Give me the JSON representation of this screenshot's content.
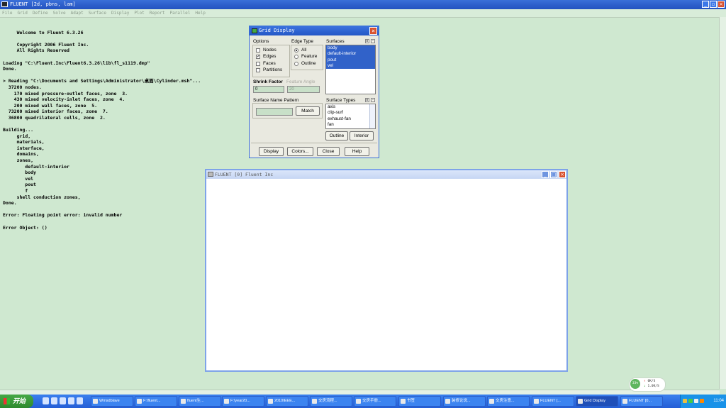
{
  "main_window": {
    "title": "FLUENT  [2d, pbns, lam]",
    "menu": [
      "File",
      "Grid",
      "Define",
      "Solve",
      "Adapt",
      "Surface",
      "Display",
      "Plot",
      "Report",
      "Parallel",
      "Help"
    ]
  },
  "console": {
    "lines": [
      "",
      "     Welcome to Fluent 6.3.26",
      "",
      "     Copyright 2006 Fluent Inc.",
      "     All Rights Reserved",
      "",
      "Loading \"C:\\Fluent.Inc\\Fluent6.3.26\\lib\\fl_s1119.dmp\"",
      "Done.",
      "",
      "> Reading \"C:\\Documents and Settings\\Administrator\\桌面\\Cylinder.msh\"...",
      "  37200 nodes.",
      "    170 mixed pressure-outlet faces, zone  3.",
      "    430 mixed velocity-inlet faces, zone  4.",
      "    200 mixed wall faces, zone  5.",
      "  73200 mixed interior faces, zone  7.",
      "  36800 quadrilateral cells, zone  2.",
      "",
      "Building...",
      "     grid,",
      "     materials,",
      "     interface,",
      "     domains,",
      "     zones,",
      "        default-interior",
      "        body",
      "        vel",
      "        pout",
      "        f",
      "     shell conduction zones,",
      "Done.",
      "",
      "Error: Floating point error: invalid number",
      "",
      "Error Object: ()"
    ]
  },
  "dialog": {
    "title": "Grid Display",
    "options_label": "Options",
    "options": [
      {
        "label": "Nodes",
        "checked": false
      },
      {
        "label": "Edges",
        "checked": true
      },
      {
        "label": "Faces",
        "checked": false
      },
      {
        "label": "Partitions",
        "checked": false
      }
    ],
    "edge_type_label": "Edge Type",
    "edge_types": [
      {
        "label": "All",
        "selected": true
      },
      {
        "label": "Feature",
        "selected": false
      },
      {
        "label": "Outline",
        "selected": false
      }
    ],
    "surfaces_label": "Surfaces",
    "surfaces": [
      "body",
      "default-interior",
      "pout",
      "vel"
    ],
    "shrink_factor_label": "Shrink Factor",
    "shrink_factor_value": "0",
    "feature_angle_label": "Feature Angle",
    "feature_angle_value": "20",
    "surface_name_pattern_label": "Surface Name Pattern",
    "match_label": "Match",
    "surface_types_label": "Surface Types",
    "surface_types": [
      "axis",
      "clip-surf",
      "exhaust-fan",
      "fan"
    ],
    "outline_label": "Outline",
    "interior_label": "Interior",
    "display_label": "Display",
    "colors_label": "Colors...",
    "close_label": "Close",
    "help_label": "Help"
  },
  "graphics_window": {
    "title": "FLUENT [0] Fluent Inc"
  },
  "network_widget": {
    "percent": "33%",
    "up": "0K/S",
    "down": "1.0K/S"
  },
  "taskbar": {
    "start_label": "开始",
    "items": [
      {
        "label": "Wmsdblave",
        "active": false
      },
      {
        "label": "F:\\fluent...",
        "active": false
      },
      {
        "label": "fluent生...",
        "active": false
      },
      {
        "label": "F:\\year20...",
        "active": false
      },
      {
        "label": "2010IEEE...",
        "active": false
      },
      {
        "label": "交房流程...",
        "active": false
      },
      {
        "label": "交房手册...",
        "active": false
      },
      {
        "label": "书签",
        "active": false
      },
      {
        "label": "装修论说...",
        "active": false
      },
      {
        "label": "交房注意...",
        "active": false
      },
      {
        "label": "FLUENT [...",
        "active": false
      },
      {
        "label": "Grid Display",
        "active": true
      },
      {
        "label": "FLUENT [0...",
        "active": false
      }
    ],
    "clock": "11:04"
  },
  "colors": {
    "background": "#cfe8d0",
    "title_blue": "#2352c0",
    "selection": "#3162c9",
    "taskbar": "#245ed6"
  }
}
